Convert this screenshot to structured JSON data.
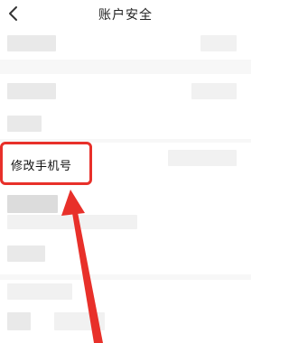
{
  "header": {
    "title": "账户安全",
    "back_icon": "chevron-left-icon"
  },
  "highlighted_item": {
    "label": "修改手机号"
  },
  "annotation": {
    "color": "#e8302a"
  }
}
